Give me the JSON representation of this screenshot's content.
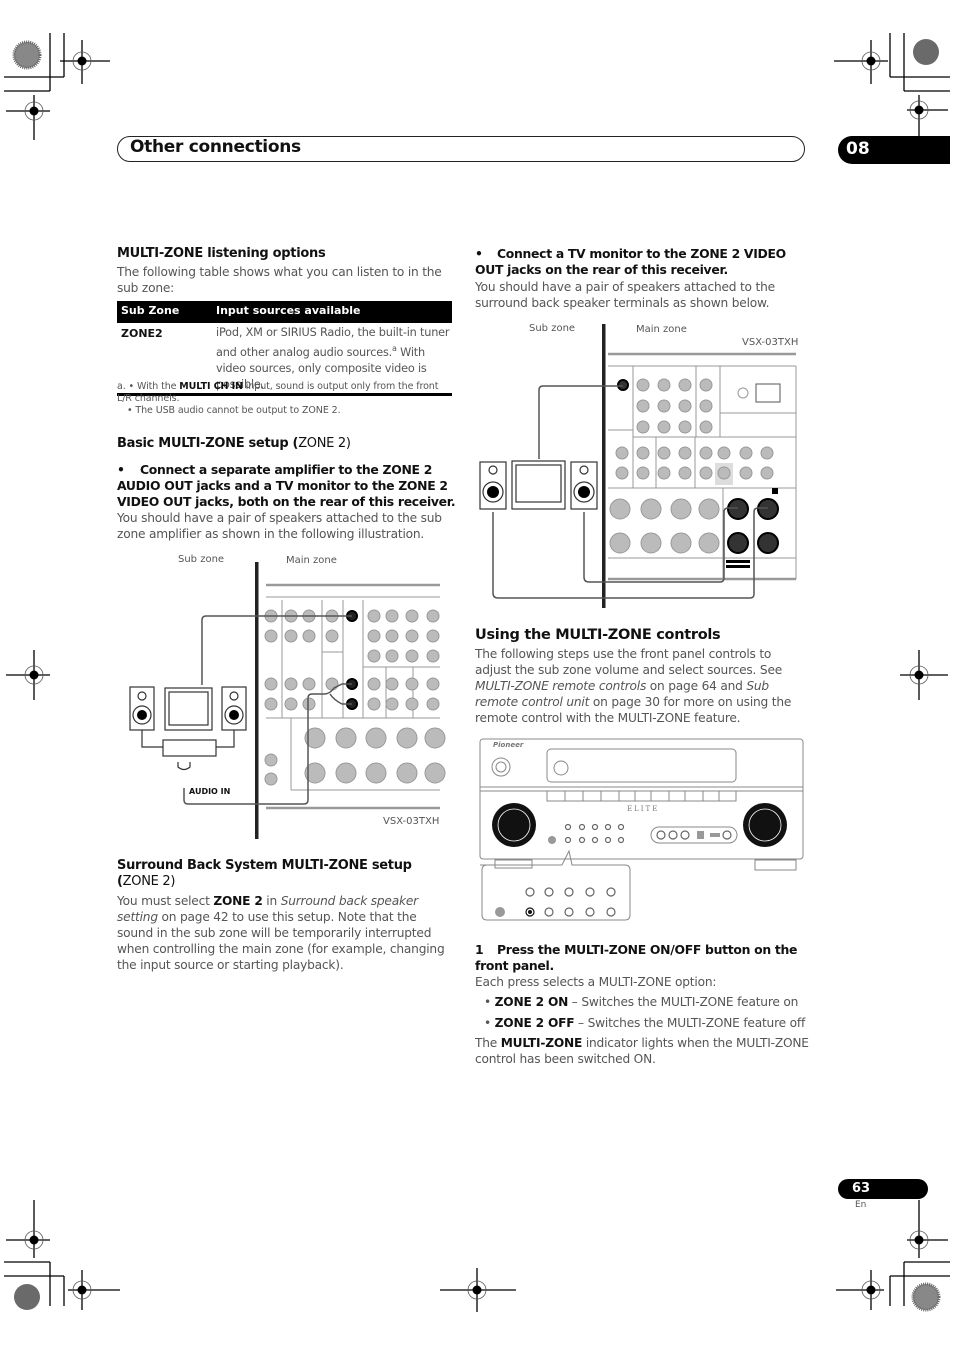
{
  "header": {
    "section_title": "Other connections",
    "chapter_number": "08"
  },
  "left": {
    "listening": {
      "title": "MULTI-ZONE listening options",
      "intro": "The following table shows what you can listen to in the sub zone:",
      "table": {
        "headers": [
          "Sub Zone",
          "Input sources available"
        ],
        "rows": [
          {
            "zone": "ZONE2",
            "sources_part1": "iPod, XM or SIRIUS Radio, the built-in tuner and other analog audio sources.",
            "footnote_ref": "a",
            "sources_part2": " With video sources, only composite video is possible."
          }
        ]
      },
      "footnotes": {
        "a_prefix": "a. • With the ",
        "a_bold": "MULTI CH IN",
        "a_suffix": " input, sound is output only from the front L/R channels.",
        "b": "• The USB audio cannot be output to ZONE 2."
      }
    },
    "basic": {
      "title_bold": "Basic MULTI-ZONE setup (",
      "title_light": "ZONE 2",
      "title_end": ")",
      "bullet": "Connect a separate amplifier to the ZONE 2 AUDIO OUT jacks and a TV monitor to the ZONE 2 VIDEO OUT jacks, both on the rear of this receiver.",
      "body": "You should have a pair of speakers attached to the sub zone amplifier as shown in the following illustration.",
      "diagram": {
        "sub_zone_label": "Sub zone",
        "main_zone_label": "Main zone",
        "audio_in_label": "AUDIO IN",
        "model_label": "VSX-03TXH"
      }
    },
    "surround": {
      "title_bold": "Surround Back System MULTI-ZONE setup (",
      "title_light": "ZONE 2",
      "title_end": ")",
      "body_1": "You must select ",
      "body_bold": "ZONE 2",
      "body_2": " in ",
      "body_italic": "Surround back speaker setting",
      "body_3": " on page 42 to use this setup. Note that the sound in the sub zone will be temporarily interrupted when controlling the main zone (for example, changing the input source or starting playback)."
    }
  },
  "right": {
    "tv": {
      "bullet": "Connect a TV monitor to the ZONE 2 VIDEO OUT jacks on the rear of this receiver.",
      "body": "You should have a pair of speakers attached to the surround back speaker terminals as shown below.",
      "diagram": {
        "sub_zone_label": "Sub zone",
        "main_zone_label": "Main zone",
        "model_label": "VSX-03TXH"
      }
    },
    "controls": {
      "title": "Using the MULTI-ZONE controls",
      "body_1": "The following steps use the front panel controls to adjust the sub zone volume and select sources. See ",
      "ref1": "MULTI-ZONE remote controls",
      "body_2": " on page 64 and ",
      "ref2": "Sub remote control unit",
      "body_3": " on page 30 for more on using the remote control with the MULTI-ZONE feature.",
      "panel": {
        "brand": "Pioneer",
        "series": "ELITE"
      }
    },
    "step1": {
      "number": "1",
      "title": "Press the MULTI-ZONE ON/OFF button on the front panel.",
      "intro": "Each press selects a MULTI-ZONE option:",
      "options": [
        {
          "name": "ZONE 2 ON",
          "desc": " – Switches the MULTI-ZONE feature on"
        },
        {
          "name": "ZONE 2 OFF",
          "desc": " – Switches the MULTI-ZONE feature off"
        }
      ],
      "indicator_1": "The ",
      "indicator_bold": "MULTI-ZONE",
      "indicator_2": " indicator lights when the MULTI-ZONE control has been switched ON."
    }
  },
  "footer": {
    "page_number": "63",
    "language": "En"
  }
}
